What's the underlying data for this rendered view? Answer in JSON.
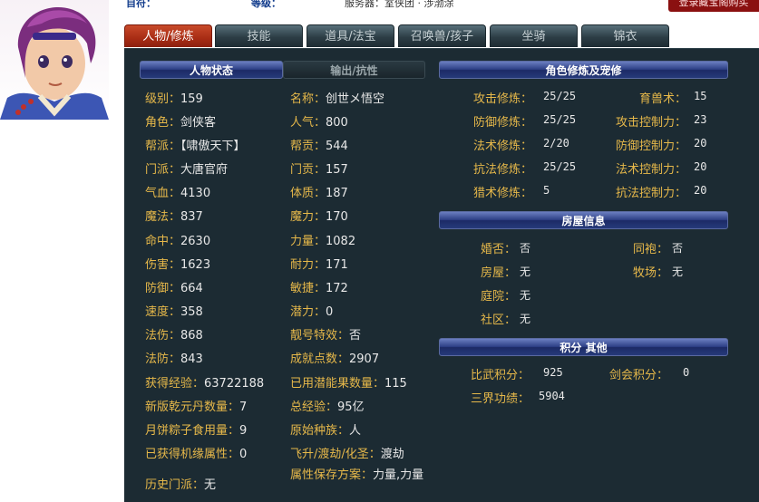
{
  "top": {
    "partial_left": "自符：",
    "partial_mid": "等级：",
    "partial_right": "服务器：室侠团 · 涉渤涂",
    "corner_button": "登录藏宝阁购买"
  },
  "tabs": [
    {
      "label": "人物/修炼",
      "active": true
    },
    {
      "label": "技能",
      "active": false
    },
    {
      "label": "道具/法宝",
      "active": false
    },
    {
      "label": "召唤兽/孩子",
      "active": false
    },
    {
      "label": "坐骑",
      "active": false
    },
    {
      "label": "锦衣",
      "active": false
    }
  ],
  "status": {
    "header_left": "人物状态",
    "header_right": "输出/抗性",
    "left": [
      {
        "label": "级别：",
        "value": "159"
      },
      {
        "label": "角色：",
        "value": "剑侠客"
      },
      {
        "label": "帮派：",
        "value": "【啸傲天下】"
      },
      {
        "label": "门派：",
        "value": "大唐官府"
      },
      {
        "label": "气血：",
        "value": "4130"
      },
      {
        "label": "魔法：",
        "value": "837"
      },
      {
        "label": "命中：",
        "value": "2630"
      },
      {
        "label": "伤害：",
        "value": "1623"
      },
      {
        "label": "防御：",
        "value": "664"
      },
      {
        "label": "速度：",
        "value": "358"
      },
      {
        "label": "法伤：",
        "value": "868"
      },
      {
        "label": "法防：",
        "value": "843"
      },
      {
        "label": "获得经验：",
        "value": "63722188"
      },
      {
        "label": "新版乾元丹数量：",
        "value": "7"
      },
      {
        "label": "月饼粽子食用量：",
        "value": "9"
      },
      {
        "label": "已获得机缘属性：",
        "value": "0"
      },
      {
        "label": "历史门派：",
        "value": "无"
      }
    ],
    "right": [
      {
        "label": "名称：",
        "value": "创世メ悟空"
      },
      {
        "label": "人气：",
        "value": "800"
      },
      {
        "label": "帮贡：",
        "value": "544"
      },
      {
        "label": "门贡：",
        "value": "157"
      },
      {
        "label": "体质：",
        "value": "187"
      },
      {
        "label": "魔力：",
        "value": "170"
      },
      {
        "label": "力量：",
        "value": "1082"
      },
      {
        "label": "耐力：",
        "value": "171"
      },
      {
        "label": "敏捷：",
        "value": "172"
      },
      {
        "label": "潜力：",
        "value": "0"
      },
      {
        "label": "靓号特效：",
        "value": "否"
      },
      {
        "label": "成就点数：",
        "value": "2907"
      },
      {
        "label": "已用潜能果数量：",
        "value": "115"
      },
      {
        "label": "总经验：",
        "value": "95亿"
      },
      {
        "label": "原始种族：",
        "value": "人"
      },
      {
        "label": "飞升/渡劫/化圣：",
        "value": "渡劫"
      },
      {
        "label": "属性保存方案：",
        "value": "力量,力量"
      }
    ]
  },
  "cultivation": {
    "header": "角色修炼及宠修",
    "left": [
      {
        "label": "攻击修炼：",
        "value": "25/25"
      },
      {
        "label": "防御修炼：",
        "value": "25/25"
      },
      {
        "label": "法术修炼：",
        "value": "2/20"
      },
      {
        "label": "抗法修炼：",
        "value": "25/25"
      },
      {
        "label": "猎术修炼：",
        "value": "5"
      }
    ],
    "right": [
      {
        "label": "育兽术：",
        "value": "15"
      },
      {
        "label": "攻击控制力：",
        "value": "23"
      },
      {
        "label": "防御控制力：",
        "value": "20"
      },
      {
        "label": "法术控制力：",
        "value": "20"
      },
      {
        "label": "抗法控制力：",
        "value": "20"
      }
    ]
  },
  "house": {
    "header": "房屋信息",
    "left": [
      {
        "label": "婚否：",
        "value": "否"
      },
      {
        "label": "房屋：",
        "value": "无"
      },
      {
        "label": "庭院：",
        "value": "无"
      },
      {
        "label": "社区：",
        "value": "无"
      }
    ],
    "right": [
      {
        "label": "同袍：",
        "value": "否"
      },
      {
        "label": "牧场：",
        "value": "无"
      }
    ]
  },
  "points": {
    "header": "积分 其他",
    "items": [
      {
        "label": "比武积分：",
        "value": "925"
      },
      {
        "label": "剑会积分：",
        "value": "0"
      },
      {
        "label": "三界功绩：",
        "value": "5904"
      }
    ]
  },
  "colors": {
    "panel_bg": "#1c2b33",
    "label": "#e6b84a",
    "value": "#e8e8e8",
    "tab_active": "#b23218"
  }
}
